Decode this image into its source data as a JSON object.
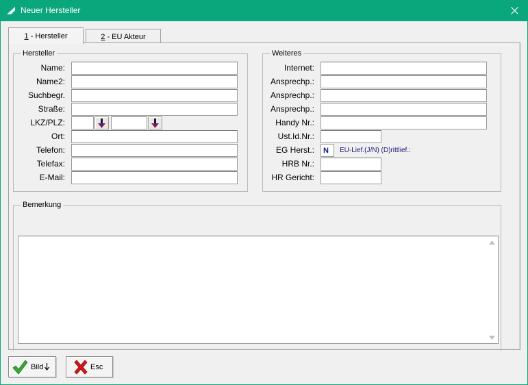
{
  "window": {
    "title": "Neuer Hersteller"
  },
  "tabs": [
    {
      "key": "1",
      "label": " - Hersteller"
    },
    {
      "key": "2",
      "label": " - EU Akteur"
    }
  ],
  "hersteller": {
    "legend": "Hersteller",
    "fields": [
      {
        "label": "Name:",
        "value": ""
      },
      {
        "label": "Name2:",
        "value": ""
      },
      {
        "label": "Suchbegr.",
        "value": ""
      },
      {
        "label": "Straße:",
        "value": ""
      },
      {
        "label": "LKZ/PLZ:",
        "lkz": "",
        "plz": ""
      },
      {
        "label": "Ort:",
        "value": ""
      },
      {
        "label": "Telefon:",
        "value": ""
      },
      {
        "label": "Telefax:",
        "value": ""
      },
      {
        "label": "E-Mail:",
        "value": ""
      }
    ]
  },
  "weiteres": {
    "legend": "Weiteres",
    "fields": [
      {
        "label": "Internet:",
        "value": ""
      },
      {
        "label": "Ansprechp.:",
        "value": ""
      },
      {
        "label": "Ansprechp.:",
        "value": ""
      },
      {
        "label": "Ansprechp.:",
        "value": ""
      },
      {
        "label": "Handy Nr.:",
        "value": ""
      },
      {
        "label": "Ust.Id.Nr.:",
        "value": ""
      },
      {
        "label": "EG Herst.:",
        "value": "N",
        "hint": "EU-Lief.(J/N) (D)rittlief.:"
      },
      {
        "label": "HRB Nr.:",
        "value": ""
      },
      {
        "label": "HR Gericht:",
        "value": ""
      }
    ]
  },
  "bemerkung": {
    "legend": "Bemerkung",
    "value": ""
  },
  "buttons": {
    "bild": "Bild",
    "esc": "Esc"
  },
  "colors": {
    "titlebar": "#0aa67c",
    "accept_check": "#3aa632",
    "cancel_x": "#d01818"
  }
}
